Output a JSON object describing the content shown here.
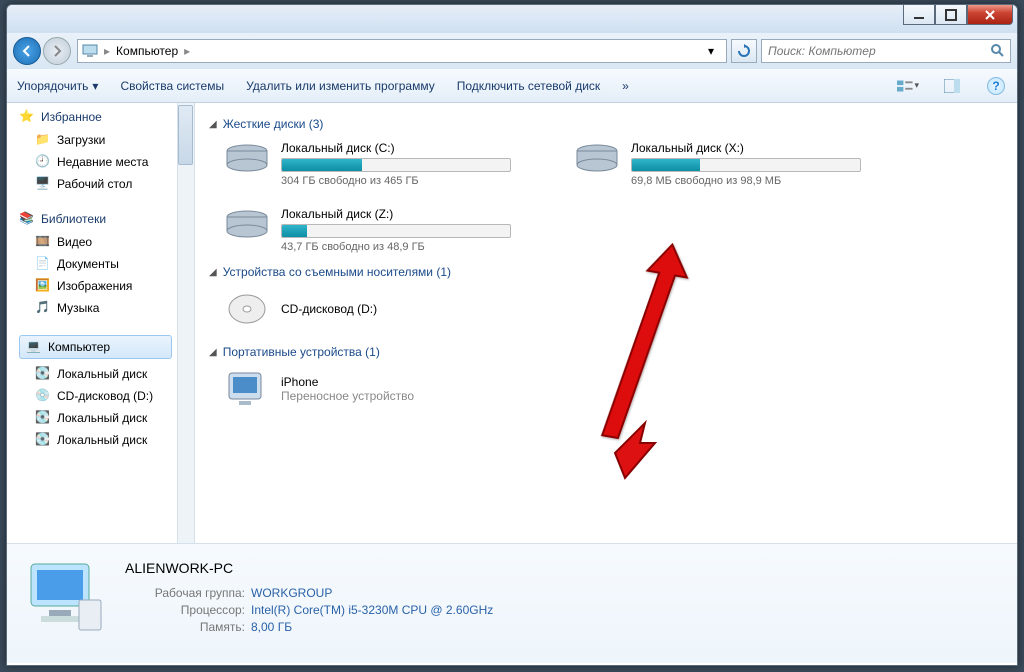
{
  "breadcrumb": {
    "root_icon": "computer-icon",
    "crumb1": "Компьютер"
  },
  "search": {
    "placeholder": "Поиск: Компьютер"
  },
  "toolbar": {
    "organize": "Упорядочить",
    "system_props": "Свойства системы",
    "uninstall": "Удалить или изменить программу",
    "map_drive": "Подключить сетевой диск"
  },
  "sidebar": {
    "favorites": {
      "title": "Избранное",
      "items": [
        "Загрузки",
        "Недавние места",
        "Рабочий стол"
      ]
    },
    "libraries": {
      "title": "Библиотеки",
      "items": [
        "Видео",
        "Документы",
        "Изображения",
        "Музыка"
      ]
    },
    "computer": {
      "title": "Компьютер",
      "items": [
        "Локальный диск",
        "CD-дисковод (D:)",
        "Локальный диск",
        "Локальный диск"
      ]
    }
  },
  "sections": {
    "hdd": {
      "title": "Жесткие диски (3)",
      "drives": [
        {
          "name": "Локальный диск (C:)",
          "free": "304 ГБ свободно из 465 ГБ",
          "fill": 35
        },
        {
          "name": "Локальный диск (X:)",
          "free": "69,8 МБ свободно из 98,9 МБ",
          "fill": 30
        },
        {
          "name": "Локальный диск (Z:)",
          "free": "43,7 ГБ свободно из 48,9 ГБ",
          "fill": 11
        }
      ]
    },
    "removable": {
      "title": "Устройства со съемными носителями (1)",
      "items": [
        {
          "name": "CD-дисковод (D:)"
        }
      ]
    },
    "portable": {
      "title": "Портативные устройства (1)",
      "items": [
        {
          "name": "iPhone",
          "sub": "Переносное устройство"
        }
      ]
    }
  },
  "details": {
    "name": "ALIENWORK-PC",
    "rows": [
      {
        "label": "Рабочая группа:",
        "value": "WORKGROUP"
      },
      {
        "label": "Процессор:",
        "value": "Intel(R) Core(TM) i5-3230M CPU @ 2.60GHz"
      },
      {
        "label": "Память:",
        "value": "8,00 ГБ"
      }
    ]
  }
}
